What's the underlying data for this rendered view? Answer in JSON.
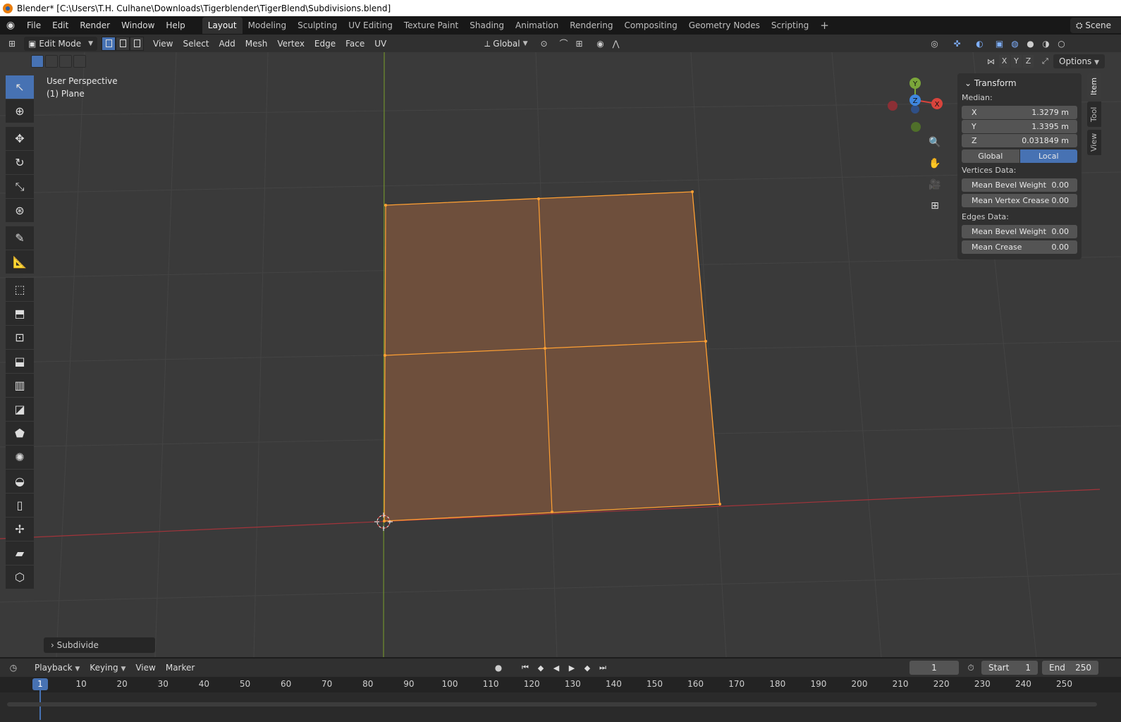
{
  "window": {
    "title": "Blender* [C:\\Users\\T.H. Culhane\\Downloads\\Tigerblender\\TigerBlend\\Subdivisions.blend]"
  },
  "top_menu": [
    "File",
    "Edit",
    "Render",
    "Window",
    "Help"
  ],
  "workspaces": [
    {
      "label": "Layout",
      "active": true
    },
    {
      "label": "Modeling"
    },
    {
      "label": "Sculpting"
    },
    {
      "label": "UV Editing"
    },
    {
      "label": "Texture Paint"
    },
    {
      "label": "Shading"
    },
    {
      "label": "Animation"
    },
    {
      "label": "Rendering"
    },
    {
      "label": "Compositing"
    },
    {
      "label": "Geometry Nodes"
    },
    {
      "label": "Scripting"
    }
  ],
  "scene_label": "Scene",
  "header": {
    "mode": "Edit Mode",
    "menus": [
      "View",
      "Select",
      "Add",
      "Mesh",
      "Vertex",
      "Edge",
      "Face",
      "UV"
    ],
    "orientation": "Global"
  },
  "viewport": {
    "perspective": "User Perspective",
    "object": "(1) Plane",
    "options_label": "Options",
    "axis_toggles": [
      "X",
      "Y",
      "Z"
    ],
    "gizmo": {
      "y": "Y",
      "z": "Z",
      "x": "X"
    },
    "last_operator": "Subdivide"
  },
  "toolbar_icons": [
    "select-box-icon",
    "cursor-icon",
    "move-icon",
    "rotate-icon",
    "scale-icon",
    "transform-icon",
    "annotate-icon",
    "measure-icon",
    "add-cube-icon",
    "extrude-icon",
    "inset-icon",
    "bevel-icon",
    "loop-cut-icon",
    "knife-icon",
    "poly-build-icon",
    "spin-icon",
    "smooth-icon",
    "edge-slide-icon",
    "shrink-fatten-icon",
    "shear-icon",
    "rip-icon"
  ],
  "npanel": {
    "section": "Transform",
    "median_label": "Median:",
    "median": [
      {
        "axis": "X",
        "value": "1.3279 m"
      },
      {
        "axis": "Y",
        "value": "1.3395 m"
      },
      {
        "axis": "Z",
        "value": "0.031849 m"
      }
    ],
    "space_toggle": {
      "global": "Global",
      "local": "Local"
    },
    "vertices_label": "Vertices Data:",
    "vertices": [
      {
        "label": "Mean Bevel Weight",
        "value": "0.00"
      },
      {
        "label": "Mean Vertex Crease",
        "value": "0.00"
      }
    ],
    "edges_label": "Edges Data:",
    "edges": [
      {
        "label": "Mean Bevel Weight",
        "value": "0.00"
      },
      {
        "label": "Mean Crease",
        "value": "0.00"
      }
    ],
    "tabs": [
      "Item",
      "Tool",
      "View"
    ]
  },
  "timeline": {
    "menus": [
      "Playback",
      "Keying",
      "View",
      "Marker"
    ],
    "current_frame": "1",
    "start_label": "Start",
    "start": "1",
    "end_label": "End",
    "end": "250",
    "ticks": [
      "10",
      "20",
      "30",
      "40",
      "50",
      "60",
      "70",
      "80",
      "90",
      "100",
      "110",
      "120",
      "130",
      "140",
      "150",
      "160",
      "170",
      "180",
      "190",
      "200",
      "210",
      "220",
      "230",
      "240",
      "250"
    ],
    "playhead_label": "1"
  },
  "colors": {
    "accent": "#4772b3",
    "selection": "#ffa033",
    "x_axis": "#d9443c",
    "y_axis": "#7ba63a"
  }
}
